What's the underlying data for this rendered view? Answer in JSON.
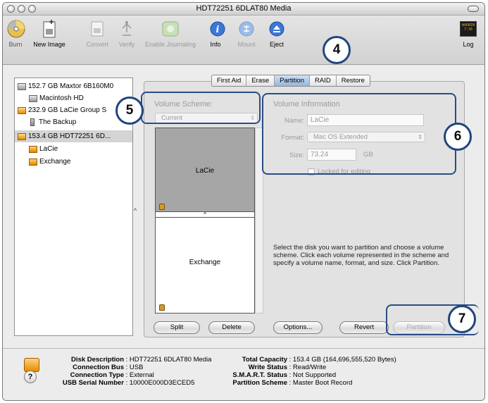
{
  "window": {
    "title": "HDT72251 6DLAT80 Media"
  },
  "toolbar": {
    "items": [
      {
        "label": "Burn",
        "icon": "burn-icon"
      },
      {
        "label": "New Image",
        "icon": "new-image-icon"
      },
      {
        "label": "Convert",
        "icon": "convert-icon"
      },
      {
        "label": "Verify",
        "icon": "verify-icon"
      },
      {
        "label": "Enable Journaling",
        "icon": "journaling-icon"
      },
      {
        "label": "Info",
        "icon": "info-icon"
      },
      {
        "label": "Mount",
        "icon": "mount-icon"
      },
      {
        "label": "Eject",
        "icon": "eject-icon"
      },
      {
        "label": "Log",
        "icon": "log-icon"
      }
    ],
    "log_icon_text": "WARNIN\n7:36"
  },
  "disks": [
    {
      "label": "152.7 GB Maxtor 6B160M0"
    },
    {
      "label": "Macintosh HD"
    },
    {
      "label": "232.9 GB LaCie Group S"
    },
    {
      "label": "The Backup"
    },
    {
      "label": "153.4 GB HDT72251 6D..."
    },
    {
      "label": "LaCie"
    },
    {
      "label": "Exchange"
    }
  ],
  "tabs": [
    "First Aid",
    "Erase",
    "Partition",
    "RAID",
    "Restore"
  ],
  "partition": {
    "volume_scheme_label": "Volume Scheme:",
    "scheme_value": "Current",
    "volumes": [
      "LaCie",
      "Exchange"
    ],
    "volume_info_label": "Volume Information",
    "name_label": "Name:",
    "name_value": "LaCie",
    "format_label": "Format:",
    "format_value": "Mac OS Extended",
    "size_label": "Size:",
    "size_value": "73.24",
    "size_unit": "GB",
    "locked_label": "Locked for editing",
    "help_text": "Select the disk you want to partition and choose a volume scheme. Click each volume represented in the scheme and specify a volume name, format, and size. Click Partition.",
    "buttons": {
      "split": "Split",
      "delete": "Delete",
      "options": "Options...",
      "revert": "Revert",
      "partition": "Partition"
    }
  },
  "info": {
    "left": [
      {
        "key": "Disk Description",
        "value": "HDT72251 6DLAT80 Media"
      },
      {
        "key": "Connection Bus",
        "value": "USB"
      },
      {
        "key": "Connection Type",
        "value": "External"
      },
      {
        "key": "USB Serial Number",
        "value": "10000E000D3ECED5"
      }
    ],
    "right": [
      {
        "key": "Total Capacity",
        "value": "153.4 GB (164,696,555,520 Bytes)"
      },
      {
        "key": "Write Status",
        "value": "Read/Write"
      },
      {
        "key": "S.M.A.R.T. Status",
        "value": "Not Supported"
      },
      {
        "key": "Partition Scheme",
        "value": "Master Boot Record"
      }
    ],
    "help": "?"
  },
  "callouts": [
    "4",
    "5",
    "6",
    "7"
  ],
  "colors": {
    "accent": "#21457e",
    "selected_tab": "#94b6de"
  }
}
